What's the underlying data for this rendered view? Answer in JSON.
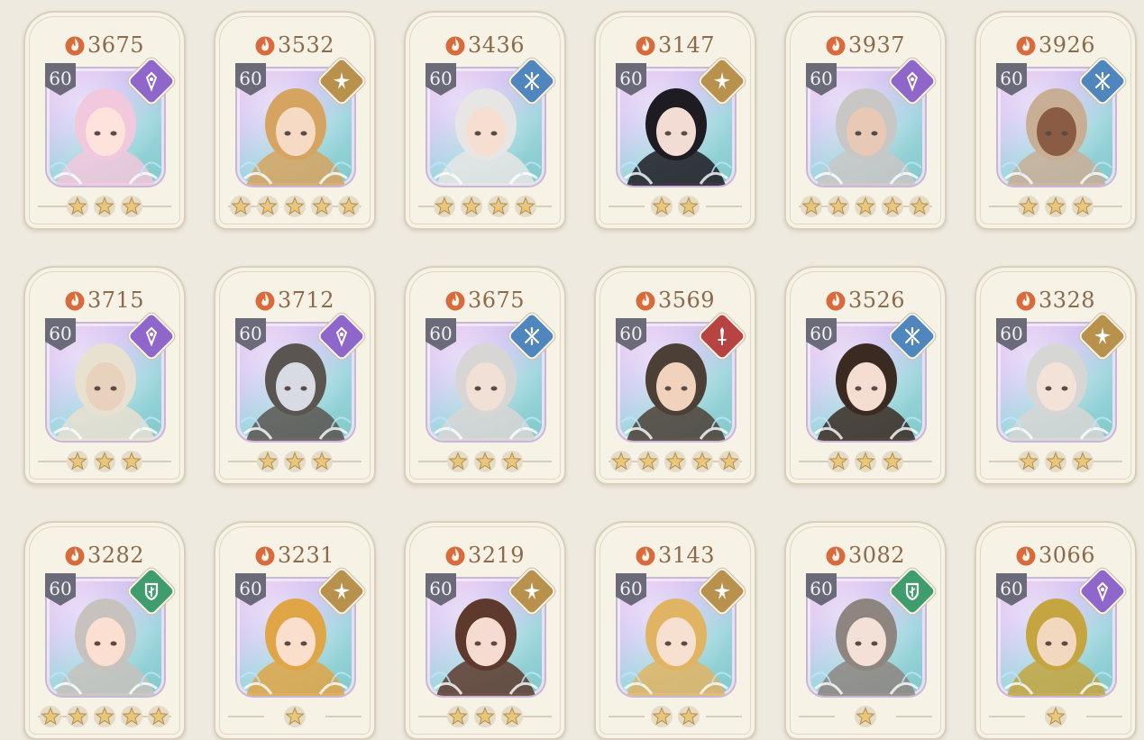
{
  "colors": {
    "mystic": "#8f66c9",
    "radiant": "#b8924c",
    "frost": "#4f86bd",
    "blade": "#b84343",
    "nature": "#3f9c6c"
  },
  "cards": [
    {
      "power": "3675",
      "level": "60",
      "class": "mystic",
      "stars": 3,
      "hair": "#f2c8dc",
      "skin": "#fde3dc"
    },
    {
      "power": "3532",
      "level": "60",
      "class": "radiant",
      "stars": 5,
      "hair": "#d6a461",
      "skin": "#f6dac4"
    },
    {
      "power": "3436",
      "level": "60",
      "class": "frost",
      "stars": 4,
      "hair": "#e8e6e4",
      "skin": "#f6dfd0"
    },
    {
      "power": "3147",
      "level": "60",
      "class": "radiant",
      "stars": 2,
      "hair": "#1e1b22",
      "skin": "#f3dcd4"
    },
    {
      "power": "3937",
      "level": "60",
      "class": "mystic",
      "stars": 5,
      "hair": "#c9c7c6",
      "skin": "#e8c9b5"
    },
    {
      "power": "3926",
      "level": "60",
      "class": "frost",
      "stars": 3,
      "hair": "#c9ae96",
      "skin": "#8a5c43"
    },
    {
      "power": "3715",
      "level": "60",
      "class": "mystic",
      "stars": 3,
      "hair": "#e9e1d0",
      "skin": "#e9d2bd"
    },
    {
      "power": "3712",
      "level": "60",
      "class": "mystic",
      "stars": 3,
      "hair": "#5a5550",
      "skin": "#d8dbe3"
    },
    {
      "power": "3675",
      "level": "60",
      "class": "frost",
      "stars": 3,
      "hair": "#d8d6d4",
      "skin": "#f0e0d6"
    },
    {
      "power": "3569",
      "level": "60",
      "class": "blade",
      "stars": 5,
      "hair": "#4c4036",
      "skin": "#f0d2bd"
    },
    {
      "power": "3526",
      "level": "60",
      "class": "frost",
      "stars": 3,
      "hair": "#3b2a22",
      "skin": "#f5ddd2"
    },
    {
      "power": "3328",
      "level": "60",
      "class": "radiant",
      "stars": 3,
      "hair": "#d6d6d4",
      "skin": "#f3e2d8"
    },
    {
      "power": "3282",
      "level": "60",
      "class": "nature",
      "stars": 5,
      "hair": "#c7c2bd",
      "skin": "#fbe0d2"
    },
    {
      "power": "3231",
      "level": "60",
      "class": "radiant",
      "stars": 1,
      "hair": "#e0a547",
      "skin": "#fae0cc"
    },
    {
      "power": "3219",
      "level": "60",
      "class": "radiant",
      "stars": 3,
      "hair": "#5e3a2d",
      "skin": "#f6dcd0"
    },
    {
      "power": "3143",
      "level": "60",
      "class": "radiant",
      "stars": 2,
      "hair": "#e1b464",
      "skin": "#f7e0cf"
    },
    {
      "power": "3082",
      "level": "60",
      "class": "nature",
      "stars": 1,
      "hair": "#8e8580",
      "skin": "#f3e0d6"
    },
    {
      "power": "3066",
      "level": "60",
      "class": "mystic",
      "stars": 1,
      "hair": "#c4a540",
      "skin": "#f1d8bf"
    }
  ]
}
